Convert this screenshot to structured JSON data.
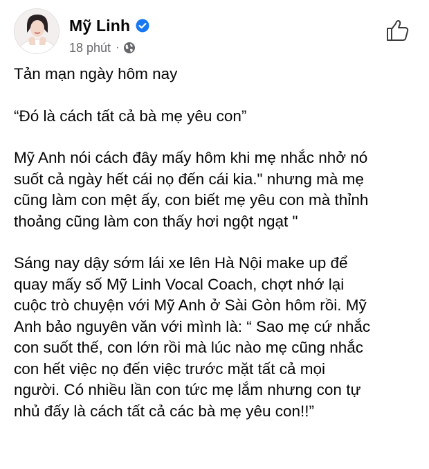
{
  "post": {
    "author": "Mỹ Linh",
    "verified_icon": "verified-badge-icon",
    "timestamp": "18 phút",
    "separator": "·",
    "audience_icon": "globe-icon",
    "like_icon": "thumbs-up-icon",
    "paragraphs": [
      "Tản mạn ngày hôm nay",
      "“Đó là cách tất cả bà mẹ yêu con”",
      "Mỹ Anh nói cách đây mấy hôm khi mẹ nhắc nhở nó\nsuốt cả ngày hết cái nọ đến cái kia.\" nhưng mà mẹ\ncũng làm con mệt ấy, con biết mẹ yêu con mà thỉnh\nthoảng cũng làm con thấy hơi ngột ngạt \"",
      "Sáng nay dậy sớm lái xe lên Hà Nội make up để\nquay mấy số Mỹ Linh Vocal Coach, chợt nhớ lại\ncuộc trò chuyện với Mỹ Anh ở Sài Gòn hôm rồi. Mỹ\nAnh bảo nguyên văn với mình là: “ Sao mẹ cứ nhắc\ncon suốt thế, con lớn rồi mà lúc nào mẹ cũng nhắc\ncon hết việc nọ đến việc trước mặt tất cả mọi\nngười. Có nhiều lần con tức mẹ lắm nhưng con tự\nnhủ đấy là cách tất cả các bà mẹ yêu con!!”"
    ],
    "colors": {
      "text": "#050505",
      "meta": "#65676b",
      "verified": "#1877f2"
    }
  }
}
